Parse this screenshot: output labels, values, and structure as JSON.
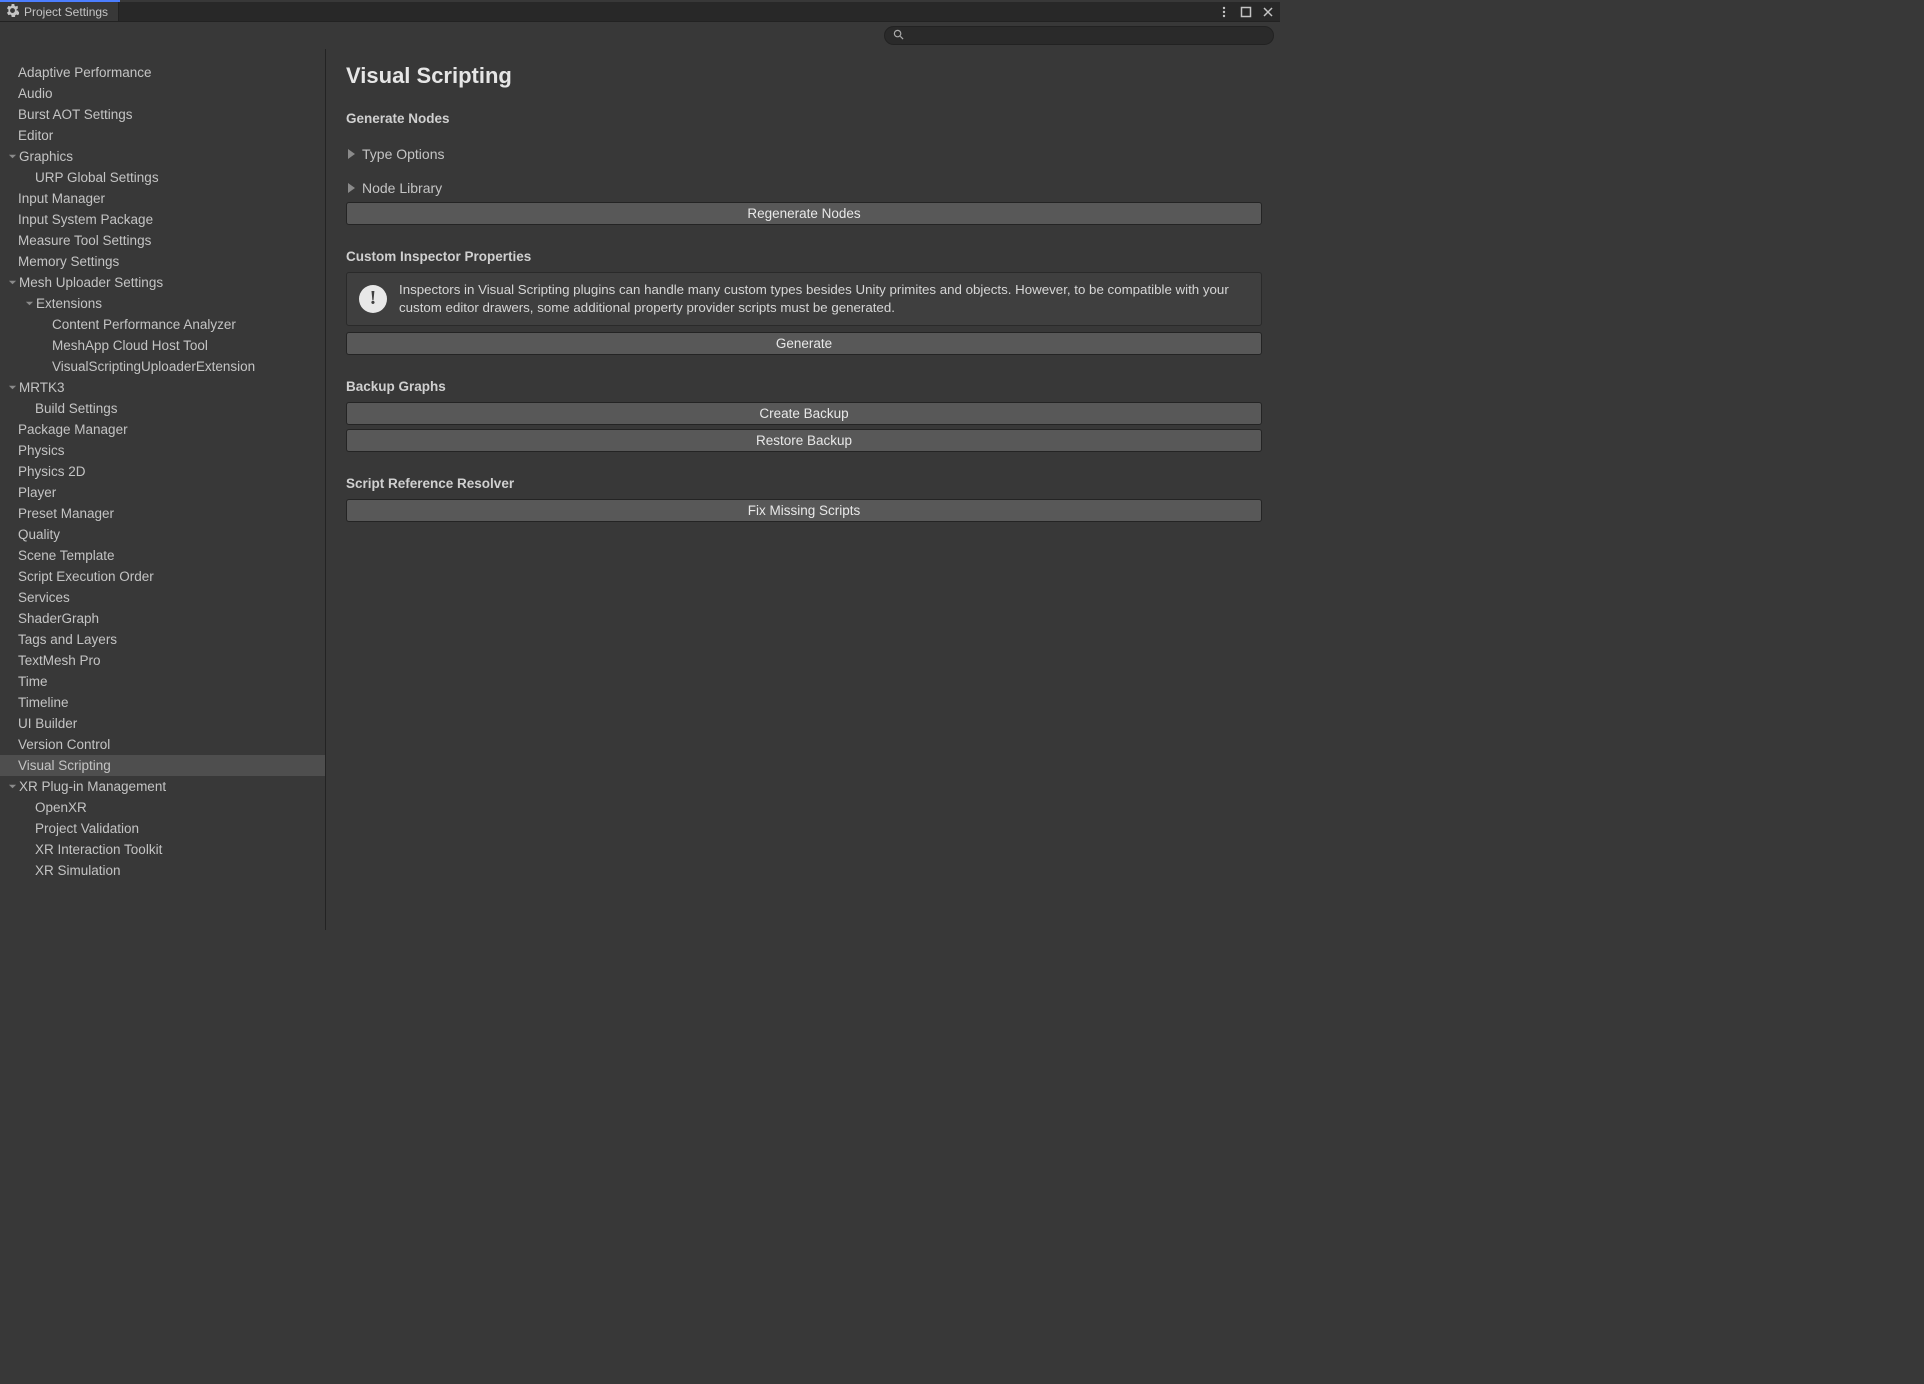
{
  "window": {
    "title": "Project Settings"
  },
  "search": {
    "placeholder": ""
  },
  "sidebar": {
    "items": [
      {
        "label": "Adaptive Performance",
        "indent": 1,
        "caret": ""
      },
      {
        "label": "Audio",
        "indent": 1,
        "caret": ""
      },
      {
        "label": "Burst AOT Settings",
        "indent": 1,
        "caret": ""
      },
      {
        "label": "Editor",
        "indent": 1,
        "caret": ""
      },
      {
        "label": "Graphics",
        "indent": 1,
        "caret": "open"
      },
      {
        "label": "URP Global Settings",
        "indent": 2,
        "caret": ""
      },
      {
        "label": "Input Manager",
        "indent": 1,
        "caret": ""
      },
      {
        "label": "Input System Package",
        "indent": 1,
        "caret": ""
      },
      {
        "label": "Measure Tool Settings",
        "indent": 1,
        "caret": ""
      },
      {
        "label": "Memory Settings",
        "indent": 1,
        "caret": ""
      },
      {
        "label": "Mesh Uploader Settings",
        "indent": 1,
        "caret": "open"
      },
      {
        "label": "Extensions",
        "indent": 2,
        "caret": "open"
      },
      {
        "label": "Content Performance Analyzer",
        "indent": 3,
        "caret": ""
      },
      {
        "label": "MeshApp Cloud Host Tool",
        "indent": 3,
        "caret": ""
      },
      {
        "label": "VisualScriptingUploaderExtension",
        "indent": 3,
        "caret": ""
      },
      {
        "label": "MRTK3",
        "indent": 1,
        "caret": "open"
      },
      {
        "label": "Build Settings",
        "indent": 2,
        "caret": ""
      },
      {
        "label": "Package Manager",
        "indent": 1,
        "caret": ""
      },
      {
        "label": "Physics",
        "indent": 1,
        "caret": ""
      },
      {
        "label": "Physics 2D",
        "indent": 1,
        "caret": ""
      },
      {
        "label": "Player",
        "indent": 1,
        "caret": ""
      },
      {
        "label": "Preset Manager",
        "indent": 1,
        "caret": ""
      },
      {
        "label": "Quality",
        "indent": 1,
        "caret": ""
      },
      {
        "label": "Scene Template",
        "indent": 1,
        "caret": ""
      },
      {
        "label": "Script Execution Order",
        "indent": 1,
        "caret": ""
      },
      {
        "label": "Services",
        "indent": 1,
        "caret": ""
      },
      {
        "label": "ShaderGraph",
        "indent": 1,
        "caret": ""
      },
      {
        "label": "Tags and Layers",
        "indent": 1,
        "caret": ""
      },
      {
        "label": "TextMesh Pro",
        "indent": 1,
        "caret": ""
      },
      {
        "label": "Time",
        "indent": 1,
        "caret": ""
      },
      {
        "label": "Timeline",
        "indent": 1,
        "caret": ""
      },
      {
        "label": "UI Builder",
        "indent": 1,
        "caret": ""
      },
      {
        "label": "Version Control",
        "indent": 1,
        "caret": ""
      },
      {
        "label": "Visual Scripting",
        "indent": 1,
        "caret": "",
        "selected": true
      },
      {
        "label": "XR Plug-in Management",
        "indent": 1,
        "caret": "open"
      },
      {
        "label": "OpenXR",
        "indent": 2,
        "caret": ""
      },
      {
        "label": "Project Validation",
        "indent": 2,
        "caret": ""
      },
      {
        "label": "XR Interaction Toolkit",
        "indent": 2,
        "caret": ""
      },
      {
        "label": "XR Simulation",
        "indent": 2,
        "caret": ""
      }
    ]
  },
  "page": {
    "title": "Visual Scripting",
    "sections": {
      "generateNodes": {
        "heading": "Generate Nodes",
        "foldouts": [
          "Type Options",
          "Node Library"
        ],
        "button": "Regenerate Nodes"
      },
      "customInspector": {
        "heading": "Custom Inspector Properties",
        "info": "Inspectors in Visual Scripting plugins can handle many custom types besides Unity primites and objects. However, to be compatible with your custom editor drawers, some additional property provider scripts must be generated.",
        "button": "Generate"
      },
      "backup": {
        "heading": "Backup Graphs",
        "buttons": [
          "Create Backup",
          "Restore Backup"
        ]
      },
      "resolver": {
        "heading": "Script Reference Resolver",
        "button": "Fix Missing Scripts"
      }
    }
  }
}
